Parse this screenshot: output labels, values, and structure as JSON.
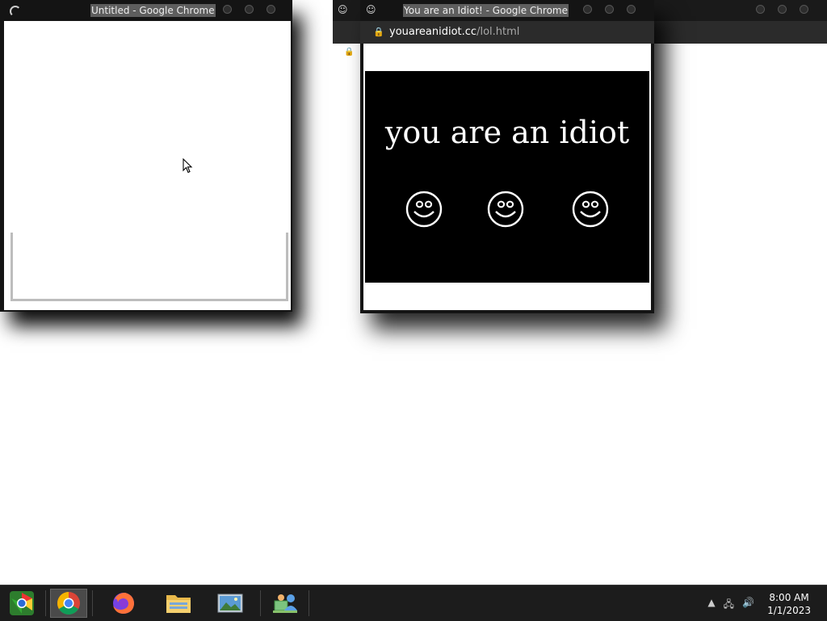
{
  "desktop": {
    "background": "#ffffff"
  },
  "windows": [
    {
      "title": "Untitled - Google Chrome",
      "state": "loading"
    },
    {
      "title": "You are an Idiot! - Google Chrome",
      "url_domain": "youareanidiot.cc",
      "url_path": "/lol.html",
      "page_text": "you are an idiot",
      "smiley_count": 3
    }
  ],
  "taskbar": {
    "apps": [
      {
        "name": "start-button",
        "icon": "start-orb-icon"
      },
      {
        "name": "google-chrome",
        "icon": "chrome-icon",
        "active": true
      },
      {
        "name": "firefox",
        "icon": "firefox-icon"
      },
      {
        "name": "file-explorer",
        "icon": "folder-icon"
      },
      {
        "name": "photo-viewer",
        "icon": "picture-icon"
      },
      {
        "name": "network-manager",
        "icon": "network-people-icon"
      }
    ],
    "clock": {
      "time": "8:00 AM",
      "date": "1/1/2023"
    }
  }
}
